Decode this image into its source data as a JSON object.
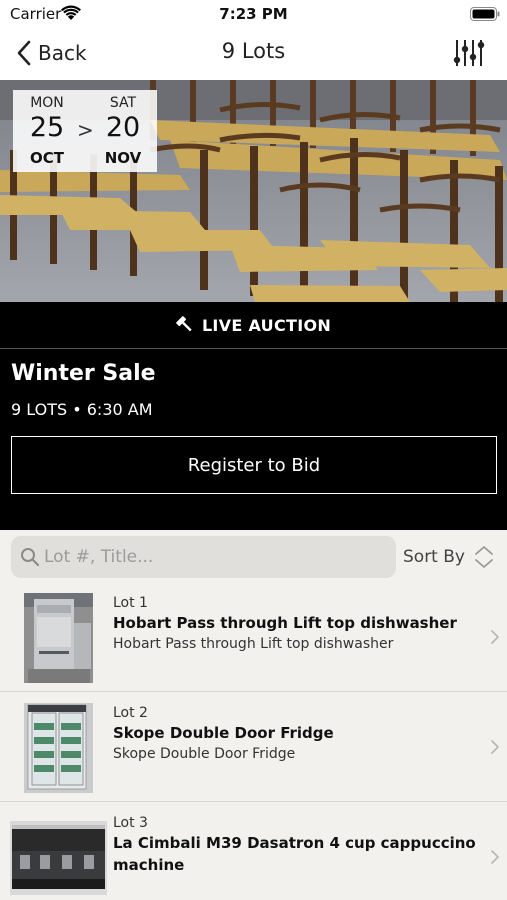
{
  "status_bar": {
    "carrier": "Carrier",
    "time": "7:23 PM"
  },
  "nav": {
    "back_label": "Back",
    "title": "9 Lots",
    "back_icon": "chevron-left-icon",
    "filter_icon": "sliders-icon"
  },
  "auction": {
    "start": {
      "dow": "MON",
      "day": "25",
      "month": "OCT"
    },
    "arrow": ">",
    "end": {
      "dow": "SAT",
      "day": "20",
      "month": "NOV"
    },
    "status_label": "LIVE AUCTION",
    "title": "Winter Sale",
    "meta": "9 LOTS • 6:30 AM",
    "register_label": "Register to Bid"
  },
  "search": {
    "placeholder": "Lot #, Title...",
    "value": "",
    "sort_label": "Sort By"
  },
  "lots": [
    {
      "number": "Lot 1",
      "title": "Hobart  Pass through Lift top dishwasher",
      "description": "Hobart Pass through Lift top dishwasher"
    },
    {
      "number": "Lot 2",
      "title": "Skope Double Door Fridge",
      "description": "Skope Double Door Fridge"
    },
    {
      "number": "Lot 3",
      "title": "La Cimbali M39 Dasatron 4 cup cappuccino machine",
      "description": ""
    }
  ],
  "colors": {
    "background": "#f2f1ee",
    "header_bg": "#000000",
    "header_text": "#ffffff",
    "search_field": "#e0dfdb"
  }
}
